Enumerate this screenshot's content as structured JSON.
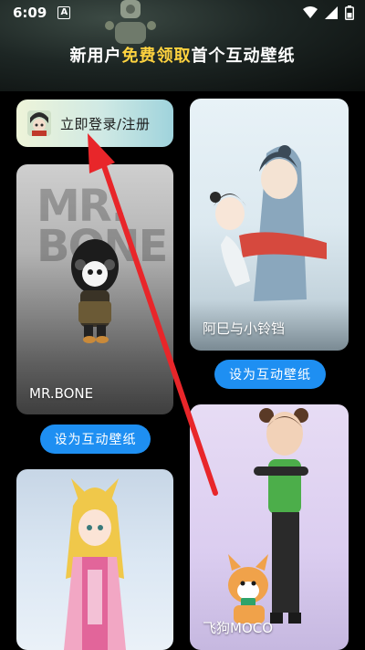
{
  "status_bar": {
    "time": "6:09",
    "notification_letter": "A"
  },
  "promo": {
    "title_prefix": "新用户",
    "title_highlight": "免费领取",
    "title_suffix": "首个互动壁纸",
    "highlight_color": "#ffd33f"
  },
  "login": {
    "label": "立即登录/注册"
  },
  "wallpapers": [
    {
      "name": "MR.BONE",
      "bg_text": "MR. BONE",
      "button": "设为互动壁纸"
    },
    {
      "name": "阿巳与小铃铛",
      "button": "设为互动壁纸"
    },
    {
      "name": "飞狗MOCO"
    }
  ],
  "colors": {
    "accent_button": "#1e8ff2",
    "arrow": "#e8262a"
  }
}
